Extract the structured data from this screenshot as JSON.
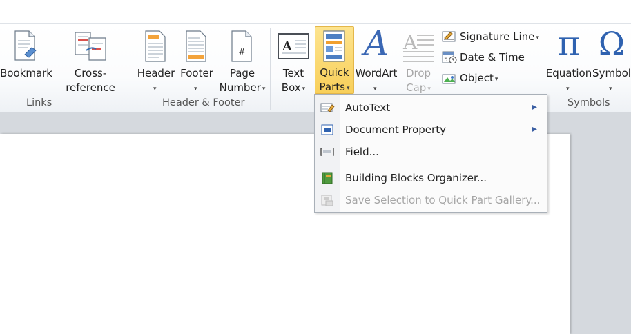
{
  "ribbon": {
    "groups": {
      "links": "Links",
      "header_footer": "Header & Footer",
      "symbols": "Symbols"
    },
    "buttons": {
      "bookmark": "Bookmark",
      "cross_reference": "Cross-reference",
      "header": "Header",
      "footer": "Footer",
      "page_number_1": "Page",
      "page_number_2": "Number",
      "text_box_1": "Text",
      "text_box_2": "Box",
      "quick_parts_1": "Quick",
      "quick_parts_2": "Parts",
      "wordart": "WordArt",
      "drop_cap_1": "Drop",
      "drop_cap_2": "Cap",
      "signature_line": "Signature Line",
      "date_time": "Date & Time",
      "object": "Object",
      "equation": "Equation",
      "symbol": "Symbol"
    },
    "icons": {
      "dropdown": "▾",
      "pi": "π",
      "omega": "Ω",
      "wordart_glyph": "A",
      "textbox_glyph": "A",
      "page_number_glyph": "#"
    }
  },
  "quick_parts_menu": {
    "items": [
      {
        "label": "AutoText",
        "submenu": true
      },
      {
        "label": "Document Property",
        "submenu": true
      },
      {
        "label": "Field...",
        "submenu": false
      },
      {
        "label": "Building Blocks Organizer...",
        "submenu": false
      },
      {
        "label": "Save Selection to Quick Part Gallery...",
        "submenu": false,
        "disabled": true
      }
    ],
    "submenu_glyph": "▶"
  }
}
